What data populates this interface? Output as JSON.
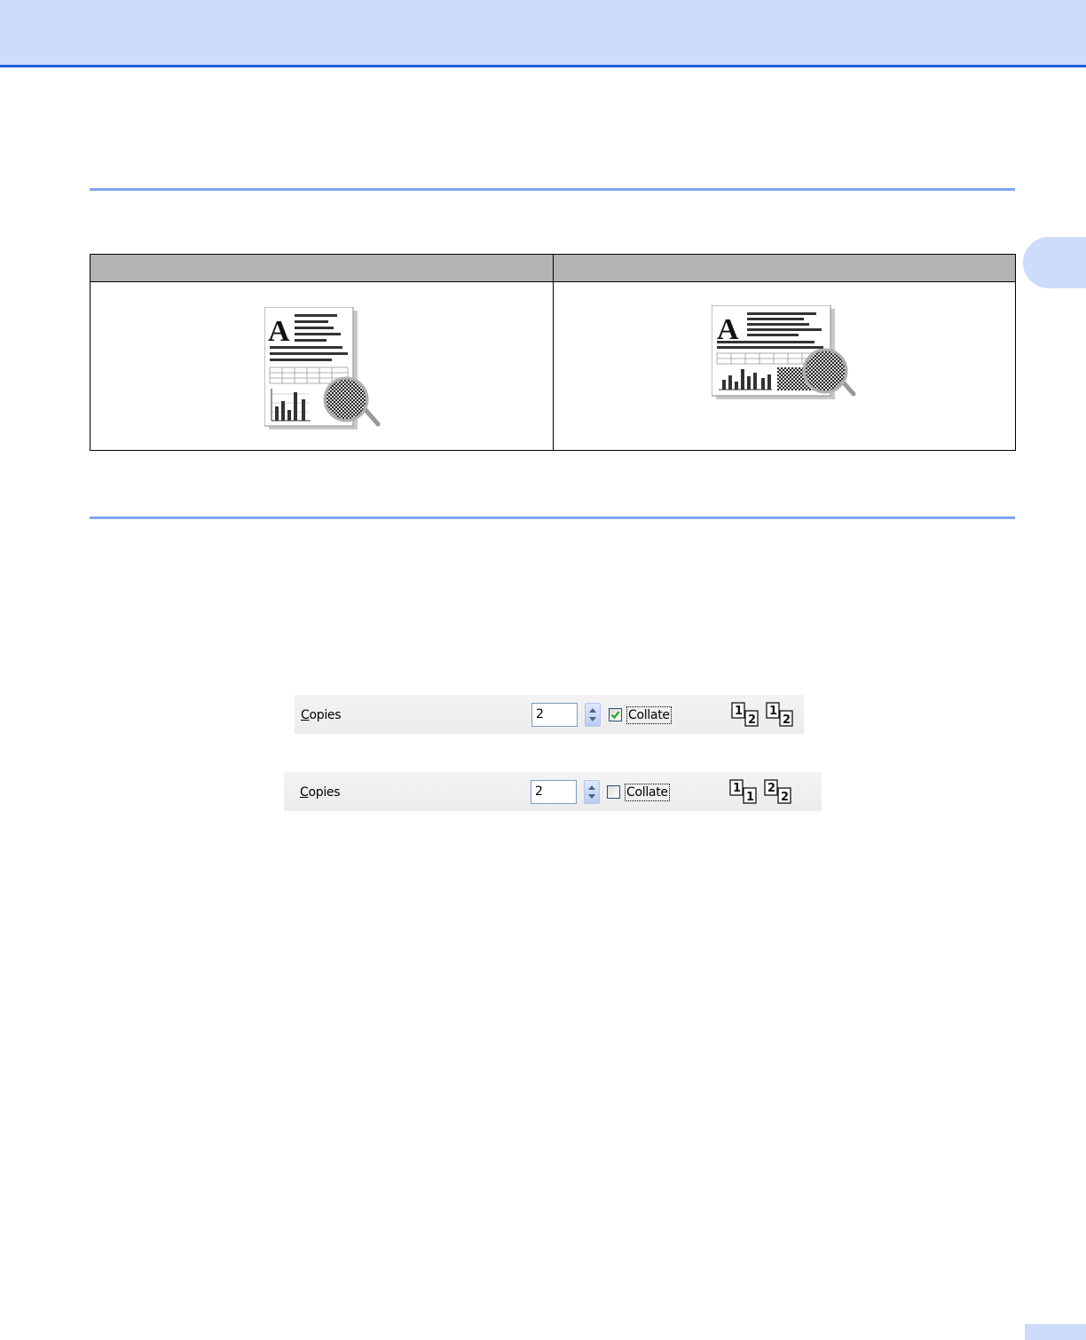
{
  "figure_orient": {
    "headers": [
      "",
      ""
    ]
  },
  "copies_collated": {
    "label_first": "C",
    "label_rest": "opies",
    "value": "2",
    "checkbox_checked": true,
    "collate_label": "Collate",
    "order_pages": [
      [
        "1",
        "2"
      ],
      [
        "1",
        "2"
      ]
    ]
  },
  "copies_uncollated": {
    "label_first": "C",
    "label_rest": "opies",
    "value": "2",
    "checkbox_checked": false,
    "collate_label": "Collate",
    "order_pages": [
      [
        "1",
        "1"
      ],
      [
        "2",
        "2"
      ]
    ]
  },
  "colors": {
    "header_band": "#cddcfb",
    "header_line": "#1f5fd6",
    "section_rule": "#7ea6ec",
    "table_header": "#b3b3b3",
    "checkmark": "#21a121"
  }
}
